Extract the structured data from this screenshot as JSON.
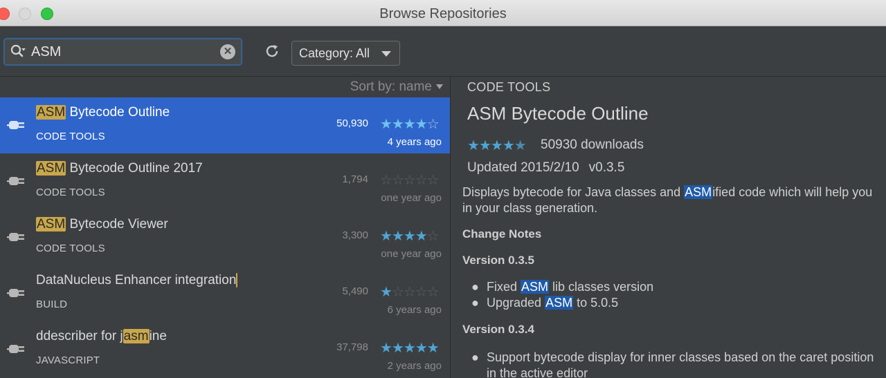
{
  "window": {
    "title": "Browse Repositories"
  },
  "toolbar": {
    "search_value": "ASM",
    "category_label": "Category: All"
  },
  "list": {
    "sort_label": "Sort by: name",
    "plugins": [
      {
        "name_prefix": "",
        "name_highlight": "ASM",
        "name_suffix": " Bytecode Outline",
        "category": "CODE TOOLS",
        "downloads": "50,930",
        "rating": 4,
        "age": "4 years ago",
        "selected": true
      },
      {
        "name_prefix": "",
        "name_highlight": "ASM",
        "name_suffix": " Bytecode Outline 2017",
        "category": "CODE TOOLS",
        "downloads": "1,794",
        "rating": 0,
        "age": "one year ago",
        "selected": false
      },
      {
        "name_prefix": "",
        "name_highlight": "ASM",
        "name_suffix": " Bytecode Viewer",
        "category": "CODE TOOLS",
        "downloads": "3,300",
        "rating": 4,
        "age": "one year ago",
        "selected": false
      },
      {
        "name_prefix": "DataNucleus Enhancer integration",
        "name_highlight": "",
        "name_suffix": "",
        "category": "BUILD",
        "downloads": "5,490",
        "rating": 1,
        "age": "6 years ago",
        "selected": false
      },
      {
        "name_prefix": "ddescriber for j",
        "name_highlight": "asm",
        "name_suffix": "ine",
        "category": "JAVASCRIPT",
        "downloads": "37,798",
        "rating": 5,
        "age": "2 years ago",
        "selected": false
      }
    ]
  },
  "detail": {
    "category": "CODE TOOLS",
    "title": "ASM Bytecode Outline",
    "rating": 4.5,
    "downloads": "50930 downloads",
    "updated": "Updated 2015/2/10",
    "version": "v0.3.5",
    "desc_before": "Displays bytecode for Java classes and ",
    "desc_highlight": "ASM",
    "desc_after": "ified code which will help you in your class generation.",
    "change_notes_heading": "Change Notes",
    "v035_heading": "Version 0.3.5",
    "v035_item1_before": "Fixed ",
    "v035_item1_highlight": "ASM",
    "v035_item1_after": " lib classes version",
    "v035_item2_before": "Upgraded ",
    "v035_item2_highlight": "ASM",
    "v035_item2_after": " to 5.0.5",
    "v034_heading": "Version 0.3.4",
    "v034_item1": "Support bytecode display for inner classes based on the caret position in the active editor"
  },
  "icons": {
    "search": "search-icon",
    "clear": "clear-icon",
    "refresh": "refresh-icon",
    "plugin": "plugin-plug-icon",
    "star": "star-icon"
  },
  "colors": {
    "selection": "#2f65ca",
    "highlight": "#c9a74a",
    "star": "#4fa4d6",
    "background": "#3c3f41"
  }
}
